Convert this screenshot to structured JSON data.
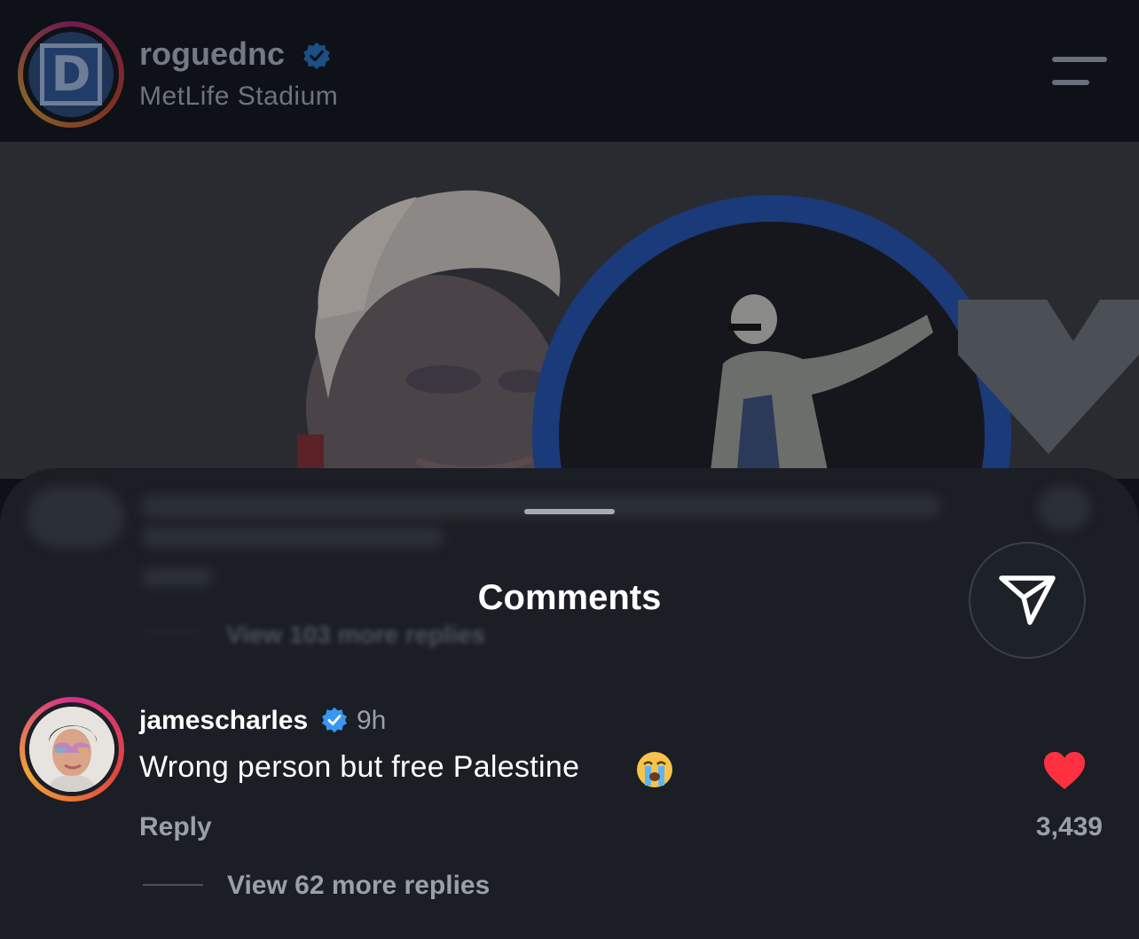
{
  "header": {
    "avatar_letter": "D",
    "username": "roguednc",
    "location": "MetLife Stadium"
  },
  "sheet": {
    "title": "Comments",
    "blurred_replies": "View 103 more replies"
  },
  "comment": {
    "username": "jamescharles",
    "time": "9h",
    "text": "Wrong person but free Palestine",
    "emoji": "loudly-crying-face",
    "reply_label": "Reply",
    "likes": "3,439",
    "liked": true,
    "view_replies": "View 62 more replies"
  },
  "colors": {
    "verified": "#3897f0",
    "heart": "#ff3040",
    "ring_dnc": "#1f4aa0"
  }
}
